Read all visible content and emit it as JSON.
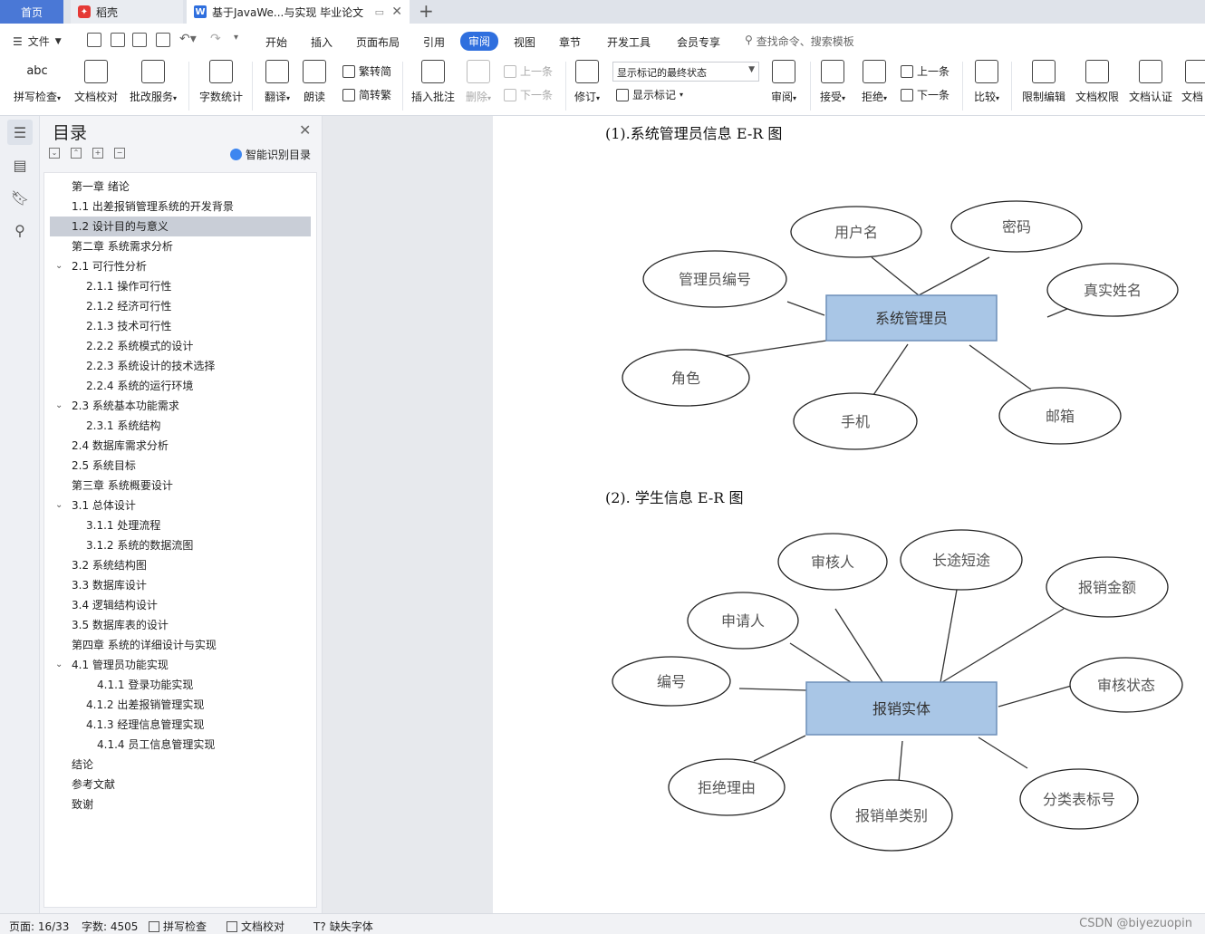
{
  "tabs": {
    "home": "首页",
    "daoke": "稻壳",
    "doc": "基于JavaWe...与实现 毕业论文"
  },
  "menu": {
    "file": "文件",
    "items": [
      "开始",
      "插入",
      "页面布局",
      "引用",
      "审阅",
      "视图",
      "章节",
      "开发工具",
      "会员专享"
    ],
    "active": "审阅",
    "search_placeholder": "查找命令、搜索模板"
  },
  "ribbon": {
    "spellcheck": "拼写检查",
    "doc_check": "文档校对",
    "revise_service": "批改服务",
    "word_count": "字数统计",
    "translate": "翻译",
    "read_aloud": "朗读",
    "to_traditional": "繁转简",
    "to_simplified": "简转繁",
    "insert_comment": "插入批注",
    "delete": "删除",
    "prev": "上一条",
    "next": "下一条",
    "track_changes": "修订",
    "markup_state": "显示标记的最终状态",
    "show_markup": "显示标记",
    "review": "审阅",
    "accept": "接受",
    "reject": "拒绝",
    "prev2": "上一条",
    "next2": "下一条",
    "compare": "比较",
    "restrict_edit": "限制编辑",
    "doc_permission": "文档权限",
    "doc_cert": "文档认证",
    "doc_more": "文档"
  },
  "toc": {
    "title": "目录",
    "smart": "智能识别目录",
    "items": [
      {
        "text": "第一章  绪论",
        "level": 1
      },
      {
        "text": "1.1  出差报销管理系统的开发背景",
        "level": 1
      },
      {
        "text": "1.2 设计目的与意义",
        "level": 1,
        "selected": true
      },
      {
        "text": "第二章  系统需求分析",
        "level": 1
      },
      {
        "text": "2.1  可行性分析",
        "level": 1,
        "caret": true
      },
      {
        "text": "2.1.1  操作可行性",
        "level": 2
      },
      {
        "text": "2.1.2  经济可行性",
        "level": 2
      },
      {
        "text": "2.1.3  技术可行性",
        "level": 2
      },
      {
        "text": "2.2.2  系统模式的设计",
        "level": 2
      },
      {
        "text": "2.2.3 系统设计的技术选择",
        "level": 2
      },
      {
        "text": "2.2.4 系统的运行环境",
        "level": 2
      },
      {
        "text": "2.3  系统基本功能需求",
        "level": 1,
        "caret": true
      },
      {
        "text": "2.3.1  系统结构",
        "level": 2
      },
      {
        "text": "2.4  数据库需求分析",
        "level": 1
      },
      {
        "text": "2.5  系统目标",
        "level": 1
      },
      {
        "text": "第三章  系统概要设计",
        "level": 1
      },
      {
        "text": "3.1 总体设计",
        "level": 1,
        "caret": true
      },
      {
        "text": "3.1.1  处理流程",
        "level": 2
      },
      {
        "text": "3.1.2 系统的数据流图",
        "level": 2
      },
      {
        "text": "3.2  系统结构图",
        "level": 1
      },
      {
        "text": "3.3 数据库设计",
        "level": 1
      },
      {
        "text": "3.4 逻辑结构设计",
        "level": 1
      },
      {
        "text": "3.5 数据库表的设计",
        "level": 1
      },
      {
        "text": "第四章  系统的详细设计与实现",
        "level": 1
      },
      {
        "text": "4.1  管理员功能实现",
        "level": 1,
        "caret": true
      },
      {
        "text": "4.1.1  登录功能实现",
        "level": 3
      },
      {
        "text": "4.1.2  出差报销管理实现",
        "level": 2
      },
      {
        "text": "4.1.3  经理信息管理实现",
        "level": 2
      },
      {
        "text": "4.1.4  员工信息管理实现",
        "level": 3
      },
      {
        "text": "结论",
        "level": 1
      },
      {
        "text": "参考文献",
        "level": 1
      },
      {
        "text": "致谢",
        "level": 1
      }
    ]
  },
  "document": {
    "heading1": "(1).系统管理员信息 E-R 图",
    "heading2": "(2).  学生信息 E-R 图",
    "er1": {
      "entity": "系统管理员",
      "attributes": [
        "用户名",
        "密码",
        "管理员编号",
        "真实姓名",
        "角色",
        "手机",
        "邮箱"
      ]
    },
    "er2": {
      "entity": "报销实体",
      "attributes": [
        "审核人",
        "长途短途",
        "报销金额",
        "申请人",
        "编号",
        "审核状态",
        "拒绝理由",
        "报销单类别",
        "分类表标号"
      ]
    }
  },
  "status": {
    "page": "页面: 16/33",
    "words": "字数: 4505",
    "spell": "拼写检查",
    "doccheck": "文档校对",
    "missing_font": "缺失字体"
  },
  "watermark": "CSDN @biyezuopin",
  "colors": {
    "accent": "#2f6fde",
    "entity_fill": "#a9c6e6",
    "entity_stroke": "#6d8fb8"
  }
}
